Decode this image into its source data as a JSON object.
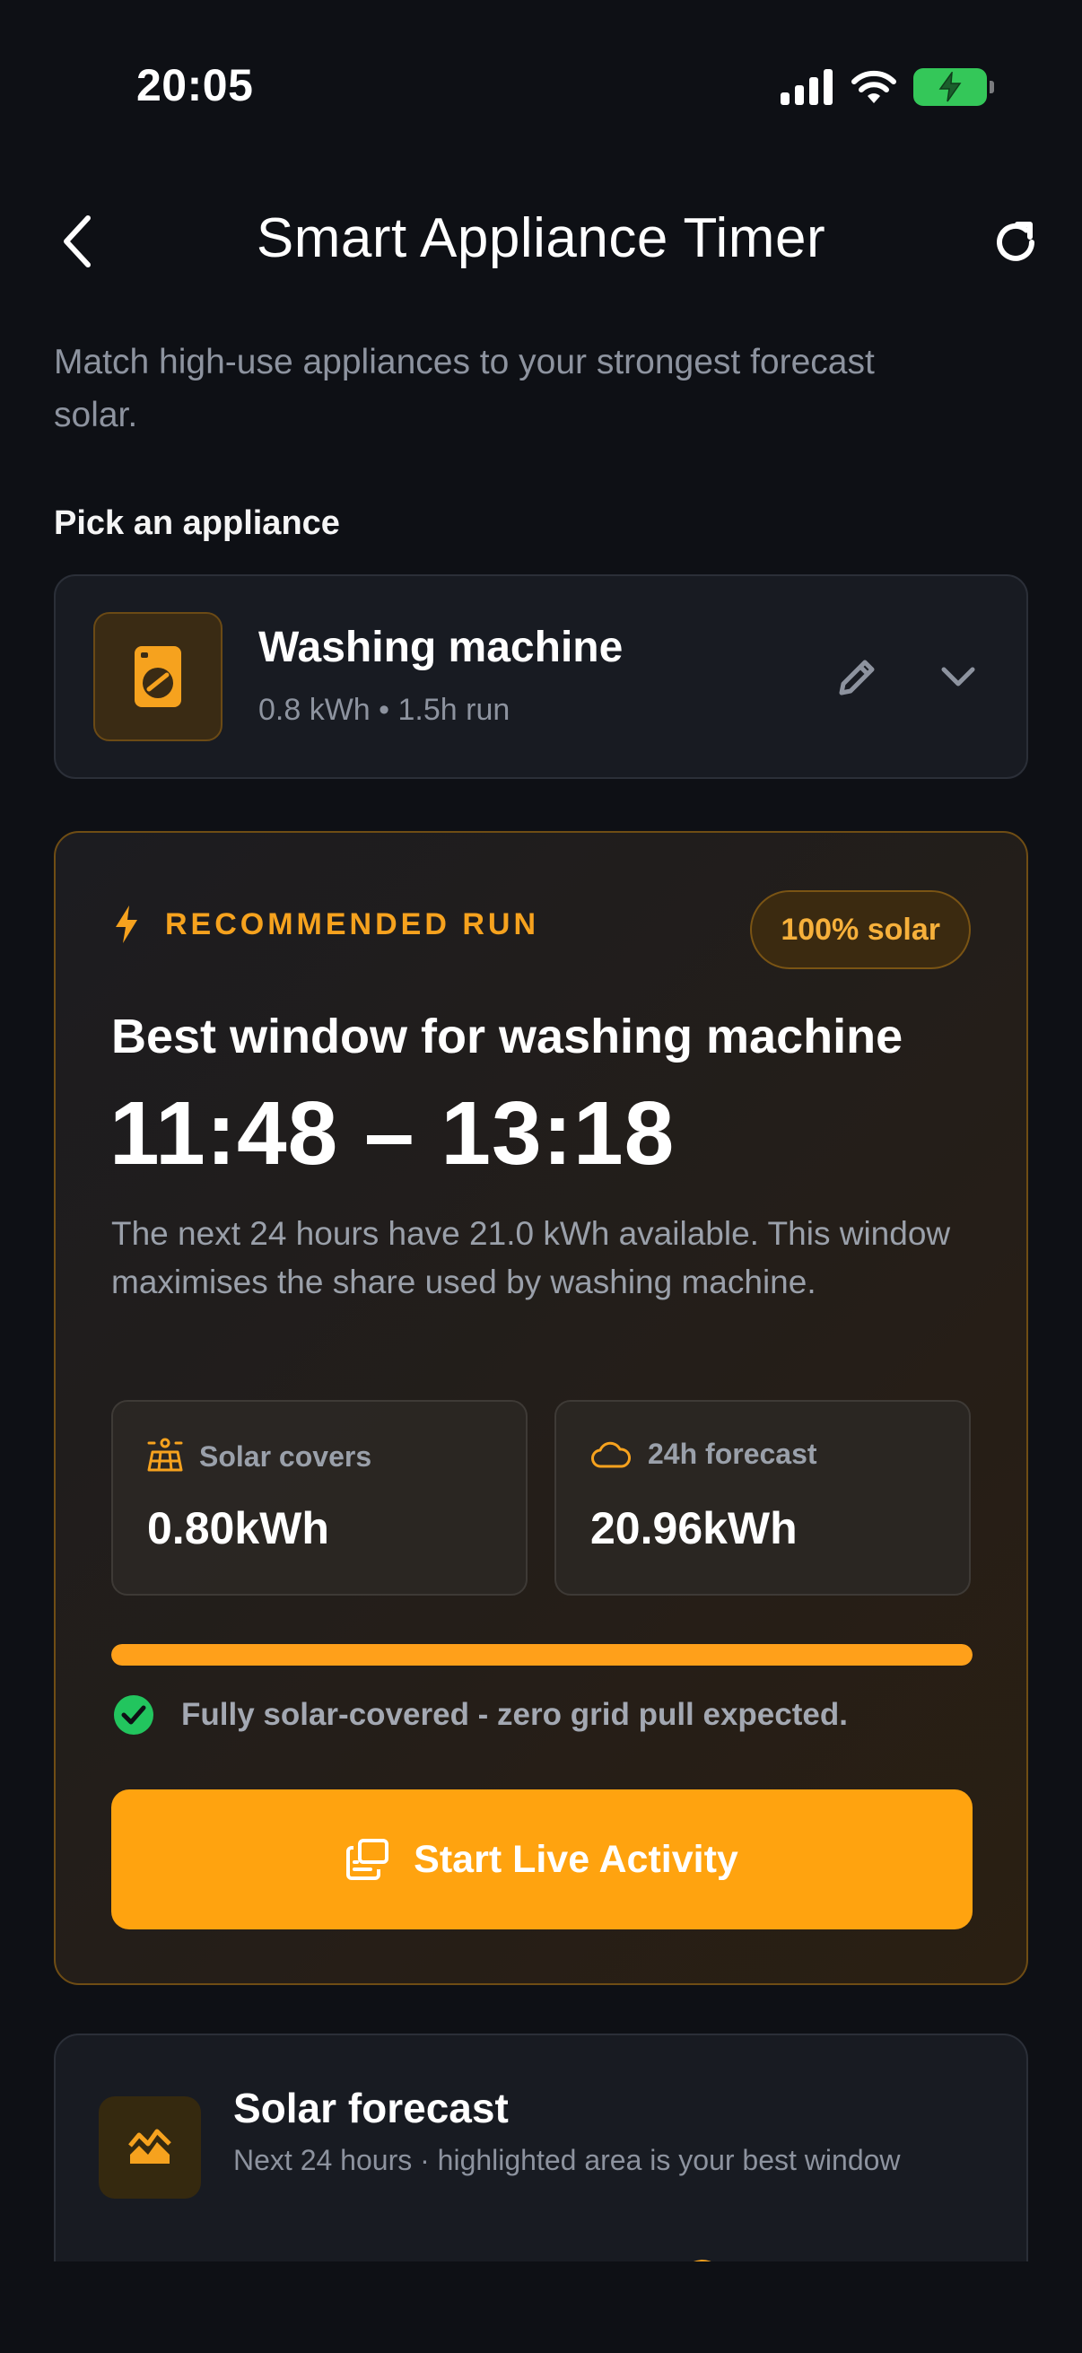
{
  "status": {
    "time": "20:05"
  },
  "header": {
    "title": "Smart Appliance Timer"
  },
  "subtitle": "Match high-use appliances to your strongest forecast solar.",
  "picker": {
    "label": "Pick an appliance",
    "appliance": {
      "name": "Washing machine",
      "meta": "0.8 kWh • 1.5h run"
    }
  },
  "recommendation": {
    "label": "RECOMMENDED RUN",
    "badge": "100% solar",
    "title": "Best window for washing machine",
    "window": "11:48 – 13:18",
    "description": "The next 24 hours have 21.0 kWh available. This window maximises the share used by washing machine.",
    "stats": [
      {
        "label": "Solar covers",
        "value": "0.80kWh"
      },
      {
        "label": "24h forecast",
        "value": "20.96kWh"
      }
    ],
    "coverage_fraction": 1.0,
    "note": "Fully solar-covered - zero grid pull expected.",
    "button_label": "Start Live Activity"
  },
  "forecast": {
    "title": "Solar forecast",
    "subtitle": "Next 24 hours · highlighted area is your best window"
  },
  "colors": {
    "accent": "#ffa30f",
    "accent_text": "#f6a21e",
    "success": "#22c55e",
    "battery": "#34c759",
    "background": "#0e1015",
    "card": "#181b22"
  }
}
